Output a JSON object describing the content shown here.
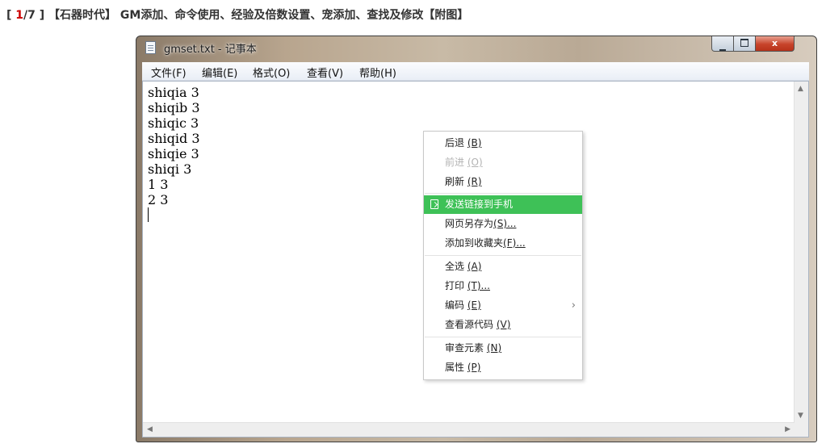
{
  "article": {
    "bracket_open": "[",
    "page_current": "1",
    "page_sep": "/7",
    "bracket_close": "]",
    "title": "【石器时代】 GM添加、命令使用、经验及倍数设置、宠添加、查找及修改【附图】"
  },
  "window": {
    "title": "gmset.txt - 记事本",
    "icon": "notepad-icon",
    "controls": {
      "close_label": "x"
    }
  },
  "menubar": [
    "文件(F)",
    "编辑(E)",
    "格式(O)",
    "查看(V)",
    "帮助(H)"
  ],
  "editor": {
    "lines": [
      "shiqia 3",
      "shiqib 3",
      "shiqic 3",
      "shiqid 3",
      "shiqie 3",
      "shiqi 3",
      "1 3",
      "2 3"
    ]
  },
  "context_menu": {
    "items": [
      {
        "label": "后退",
        "key": "(B)",
        "state": "normal"
      },
      {
        "label": "前进",
        "key": "(O)",
        "state": "disabled"
      },
      {
        "label": "刷新",
        "key": "(R)",
        "state": "normal"
      },
      {
        "label": "发送链接到手机",
        "key": "",
        "state": "highlighted",
        "icon": "send-to-phone-icon"
      },
      {
        "label": "网页另存为",
        "key": "(S)...",
        "state": "normal"
      },
      {
        "label": "添加到收藏夹",
        "key": "(F)...",
        "state": "normal"
      },
      {
        "label": "全选",
        "key": "(A)",
        "state": "normal"
      },
      {
        "label": "打印",
        "key": "(T)...",
        "state": "normal"
      },
      {
        "label": "编码",
        "key": "(E)",
        "state": "normal",
        "submenu": true
      },
      {
        "label": "查看源代码",
        "key": "(V)",
        "state": "normal"
      },
      {
        "label": "审查元素",
        "key": "(N)",
        "state": "normal"
      },
      {
        "label": "属性",
        "key": "(P)",
        "state": "normal"
      }
    ]
  },
  "colors": {
    "highlight": "#3ec157",
    "page_number": "#cc0000"
  }
}
